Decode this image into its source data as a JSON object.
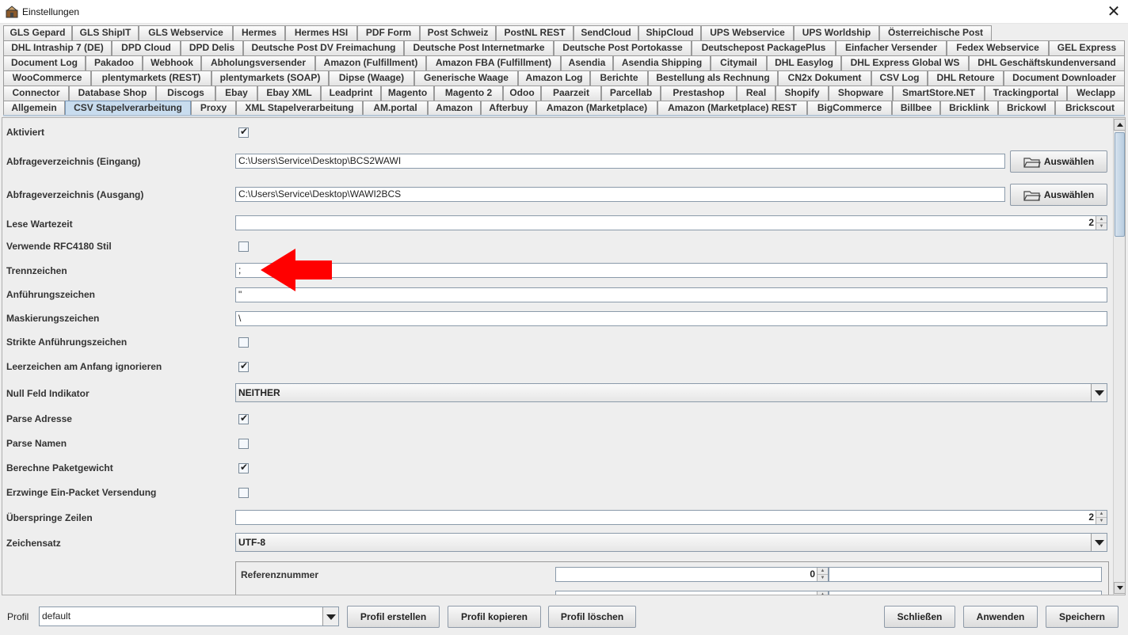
{
  "window": {
    "title": "Einstellungen",
    "close_symbol": "✕"
  },
  "tabs": {
    "row1": [
      "GLS Gepard",
      "GLS ShipIT",
      "GLS Webservice",
      "Hermes",
      "Hermes HSI",
      "PDF Form",
      "Post Schweiz",
      "PostNL REST",
      "SendCloud",
      "ShipCloud",
      "UPS Webservice",
      "UPS Worldship",
      "Österreichische Post"
    ],
    "row2": [
      "DHL Intraship 7 (DE)",
      "DPD Cloud",
      "DPD Delis",
      "Deutsche Post DV Freimachung",
      "Deutsche Post Internetmarke",
      "Deutsche Post Portokasse",
      "Deutschepost PackagePlus",
      "Einfacher Versender",
      "Fedex Webservice",
      "GEL Express"
    ],
    "row3": [
      "Document Log",
      "Pakadoo",
      "Webhook",
      "Abholungsversender",
      "Amazon (Fulfillment)",
      "Amazon FBA (Fulfillment)",
      "Asendia",
      "Asendia Shipping",
      "Citymail",
      "DHL Easylog",
      "DHL Express Global WS",
      "DHL Geschäftskundenversand"
    ],
    "row4": [
      "WooCommerce",
      "plentymarkets (REST)",
      "plentymarkets (SOAP)",
      "Dipse (Waage)",
      "Generische Waage",
      "Amazon Log",
      "Berichte",
      "Bestellung als Rechnung",
      "CN2x Dokument",
      "CSV Log",
      "DHL Retoure",
      "Document Downloader"
    ],
    "row5": [
      "Connector",
      "Database Shop",
      "Discogs",
      "Ebay",
      "Ebay XML",
      "Leadprint",
      "Magento",
      "Magento 2",
      "Odoo",
      "Paarzeit",
      "Parcellab",
      "Prestashop",
      "Real",
      "Shopify",
      "Shopware",
      "SmartStore.NET",
      "Trackingportal",
      "Weclapp"
    ],
    "row6": [
      "Allgemein",
      "CSV Stapelverarbeitung",
      "Proxy",
      "XML Stapelverarbeitung",
      "AM.portal",
      "Amazon",
      "Afterbuy",
      "Amazon (Marketplace)",
      "Amazon (Marketplace) REST",
      "BigCommerce",
      "Billbee",
      "Bricklink",
      "Brickowl",
      "Brickscout"
    ],
    "selected": "CSV Stapelverarbeitung"
  },
  "form": {
    "aktiviert": {
      "label": "Aktiviert",
      "checked": true
    },
    "abfrage_eingang": {
      "label": "Abfrageverzeichnis (Eingang)",
      "value": "C:\\Users\\Service\\Desktop\\BCS2WAWI",
      "button": "Auswählen"
    },
    "abfrage_ausgang": {
      "label": "Abfrageverzeichnis (Ausgang)",
      "value": "C:\\Users\\Service\\Desktop\\WAWI2BCS",
      "button": "Auswählen"
    },
    "lese_wartezeit": {
      "label": "Lese Wartezeit",
      "value": "2"
    },
    "rfc4180": {
      "label": "Verwende RFC4180 Stil",
      "checked": false
    },
    "trennzeichen": {
      "label": "Trennzeichen",
      "value": ";"
    },
    "anfuehrungszeichen": {
      "label": "Anführungszeichen",
      "value": "\""
    },
    "maskierungszeichen": {
      "label": "Maskierungszeichen",
      "value": "\\"
    },
    "strikte": {
      "label": "Strikte Anführungszeichen",
      "checked": false
    },
    "leerzeichen": {
      "label": "Leerzeichen am Anfang ignorieren",
      "checked": true
    },
    "null_feld": {
      "label": "Null Feld Indikator",
      "value": "NEITHER"
    },
    "parse_adresse": {
      "label": "Parse Adresse",
      "checked": true
    },
    "parse_namen": {
      "label": "Parse Namen",
      "checked": false
    },
    "paketgewicht": {
      "label": "Berechne Paketgewicht",
      "checked": true
    },
    "ein_packet": {
      "label": "Erzwinge Ein-Packet Versendung",
      "checked": false
    },
    "ueberspringe": {
      "label": "Überspringe Zeilen",
      "value": "2"
    },
    "zeichensatz": {
      "label": "Zeichensatz",
      "value": "UTF-8"
    },
    "referenz": {
      "label": "Referenznummer",
      "value": "0"
    }
  },
  "check_mark": "✔",
  "bottom": {
    "profil_label": "Profil",
    "profil_value": "default",
    "erstellen": "Profil erstellen",
    "kopieren": "Profil kopieren",
    "loeschen": "Profil löschen",
    "schliessen": "Schließen",
    "anwenden": "Anwenden",
    "speichern": "Speichern"
  },
  "colors": {
    "selected_tab": "#c8dcee",
    "annotation_arrow": "#ff0000"
  }
}
